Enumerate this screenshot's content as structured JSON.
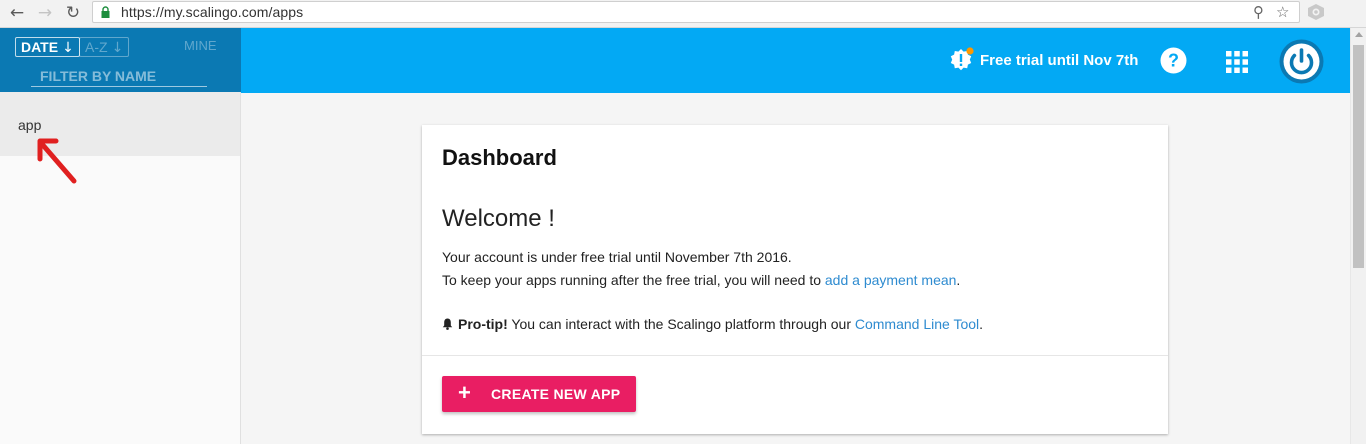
{
  "browser": {
    "url": "https://my.scalingo.com/apps",
    "back_glyph": "←",
    "forward_glyph": "→",
    "reload_glyph": "↻",
    "key_glyph": "⚲",
    "star_glyph": "☆"
  },
  "sidebar": {
    "sort_date_label": "DATE",
    "sort_date_arrow": "↓",
    "sort_az_label": "A-Z",
    "sort_az_arrow": "↓",
    "mine_label": "MINE",
    "filter_placeholder": "FILTER BY NAME",
    "apps": [
      {
        "name": "app"
      }
    ]
  },
  "topbar": {
    "trial_text": "Free trial until Nov 7th",
    "icons": [
      "warning-badge-icon",
      "help-icon",
      "apps-grid-icon",
      "power-icon"
    ]
  },
  "dashboard": {
    "title": "Dashboard",
    "welcome": "Welcome !",
    "line1": "Your account is under free trial until November 7th 2016.",
    "line2_prefix": "To keep your apps running after the free trial, you will need to ",
    "line2_link": "add a payment mean",
    "line2_suffix": ".",
    "protip_label": "Pro-tip!",
    "protip_text": " You can interact with the Scalingo platform through our ",
    "protip_link": "Command Line Tool",
    "protip_suffix": ".",
    "create_plus": "+",
    "create_label": "CREATE NEW APP"
  },
  "colors": {
    "topbar": "#03a9f4",
    "sidebar_header": "#0b79b3",
    "create_button": "#e91e63",
    "link": "#2e8bd0",
    "annotation_arrow": "#e02020"
  }
}
